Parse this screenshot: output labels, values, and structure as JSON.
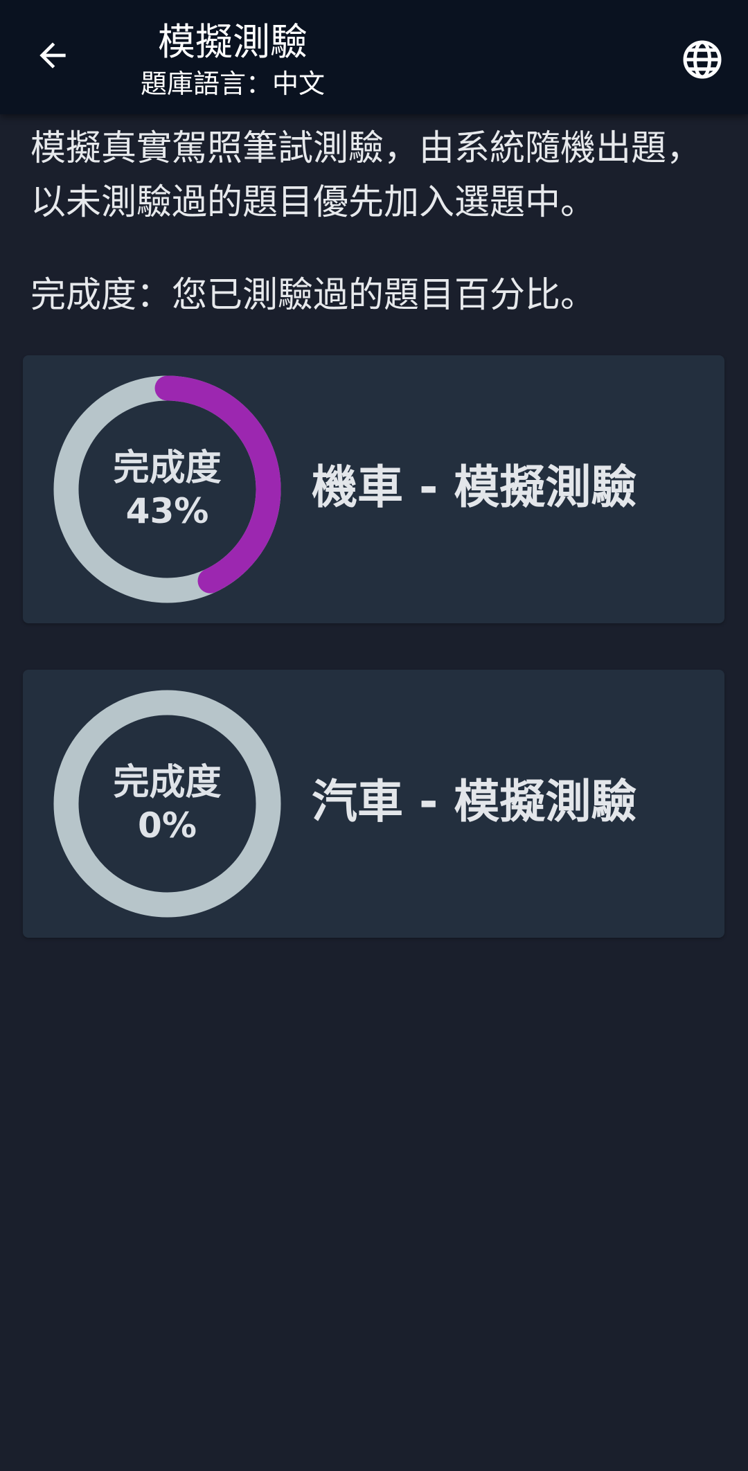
{
  "header": {
    "title": "模擬測驗",
    "subtitle": "題庫語言：中文",
    "back_icon": "arrow-left-icon",
    "language_icon": "globe-icon"
  },
  "description": {
    "line1": "模擬真實駕照筆試測驗，由系統隨機出題，以未測驗過的題目優先加入選題中。",
    "line2": "完成度：您已測驗過的題目百分比。"
  },
  "cards": [
    {
      "title": "機車 - 模擬測驗",
      "progress_label": "完成度",
      "progress_text": "43%",
      "progress": 0.43
    },
    {
      "title": "汽車 - 模擬測驗",
      "progress_label": "完成度",
      "progress_text": "0%",
      "progress": 0
    }
  ],
  "colors": {
    "background": "#1a1f2c",
    "appbar": "#0a1220",
    "card": "#232f3e",
    "ring_track": "#b7c5ca",
    "ring_progress": "#9c27b0"
  }
}
